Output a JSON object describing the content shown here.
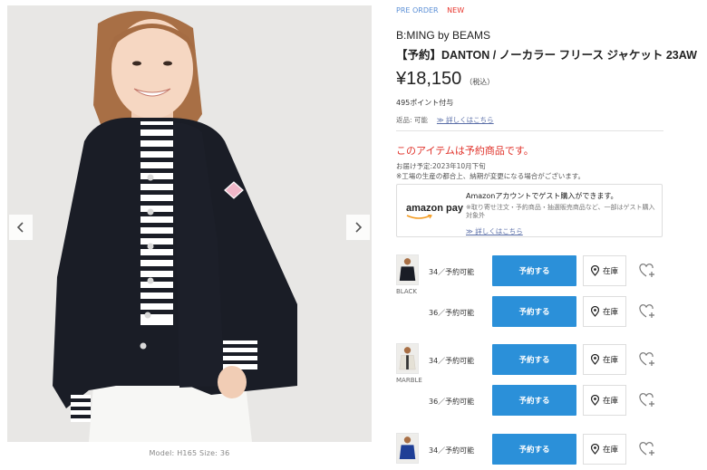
{
  "gallery": {
    "caption": "Model: H165   Size: 36",
    "prev_icon": "chevron-left-icon",
    "next_icon": "chevron-right-icon"
  },
  "product": {
    "tag_preorder": "PRE ORDER",
    "tag_new": "NEW",
    "brand": "B:MING by BEAMS",
    "title": "【予約】DANTON / ノーカラー フリース ジャケット 23AW",
    "price": "¥18,150",
    "tax_label": "（税込）",
    "points": "495ポイント付与",
    "return_label": "返品: 可能",
    "return_link": "≫ 詳しくはこちら",
    "preorder_notice": "このアイテムは予約商品です。",
    "delivery": "お届け予定:2023年10月下旬",
    "note": "※工場の生産の都合上、納期が変更になる場合がございます。"
  },
  "amazon": {
    "logo_text": "amazon pay",
    "main": "Amazonアカウントでゲスト購入ができます。",
    "sub": "※取り寄せ注文・予約商品・抽選販売商品など、一部はゲスト購入対象外",
    "link": "≫ 詳しくはこちら"
  },
  "colors": {
    "accent": "#2b90d9",
    "notice": "#e0322a",
    "tag_new": "#e8362d",
    "tag_preorder": "#5b8fd6"
  },
  "skus": [
    {
      "color_label": "BLACK",
      "stock": "34／予約可能",
      "button": "予約する",
      "store": "在庫",
      "swatch": "#1a1d26"
    },
    {
      "color_label": "",
      "stock": "36／予約可能",
      "button": "予約する",
      "store": "在庫",
      "swatch": ""
    },
    {
      "color_label": "MARBLE",
      "stock": "34／予約可能",
      "button": "予約する",
      "store": "在庫",
      "swatch": "#e9e6dc"
    },
    {
      "color_label": "",
      "stock": "36／予約可能",
      "button": "予約する",
      "store": "在庫",
      "swatch": ""
    },
    {
      "color_label": "",
      "stock": "34／予約可能",
      "button": "予約する",
      "store": "在庫",
      "swatch": "#1f3f96"
    }
  ]
}
